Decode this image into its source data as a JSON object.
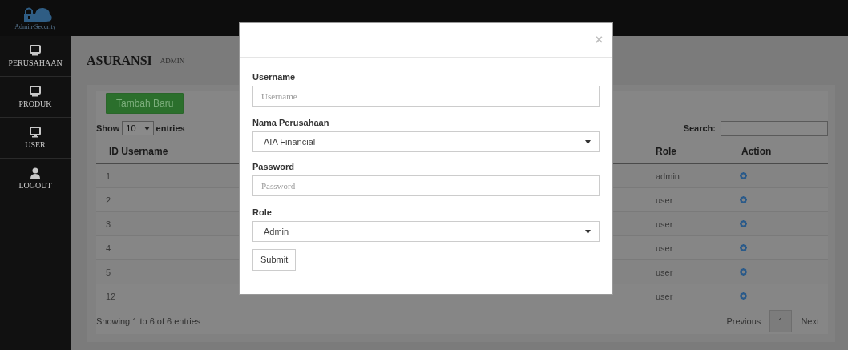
{
  "topbar": {
    "logo_text": "Admin-Security"
  },
  "sidebar": {
    "items": [
      {
        "label": "PERUSAHAAN",
        "kind": "monitor"
      },
      {
        "label": "PRODUK",
        "kind": "monitor"
      },
      {
        "label": "USER",
        "kind": "monitor"
      },
      {
        "label": "LOGOUT",
        "kind": "person"
      }
    ]
  },
  "page": {
    "title": "ASURANSI",
    "subtitle": "ADMIN"
  },
  "add_button": "Tambah Baru",
  "length_control": {
    "show": "Show",
    "value": "10",
    "entries": "entries"
  },
  "search": {
    "label": "Search:"
  },
  "table": {
    "columns": [
      "ID Username",
      "Role",
      "Action"
    ],
    "rows": [
      {
        "id": "1",
        "role": "admin"
      },
      {
        "id": "2",
        "role": "user"
      },
      {
        "id": "3",
        "role": "user"
      },
      {
        "id": "4",
        "role": "user"
      },
      {
        "id": "5",
        "role": "user"
      },
      {
        "id": "12",
        "role": "user"
      }
    ]
  },
  "footer": {
    "info": "Showing 1 to 6 of 6 entries",
    "pagination": [
      {
        "label": "Previous",
        "selected": false
      },
      {
        "label": "1",
        "selected": true
      },
      {
        "label": "Next",
        "selected": false
      }
    ]
  },
  "modal": {
    "close": "×",
    "fields": [
      {
        "label": "Username",
        "kind": "text",
        "placeholder": "Username"
      },
      {
        "label": "Nama Perusahaan",
        "kind": "select",
        "value": "AIA Financial"
      },
      {
        "label": "Password",
        "kind": "password",
        "placeholder": "Password"
      },
      {
        "label": "Role",
        "kind": "select",
        "value": "Admin"
      }
    ],
    "submit": "Submit"
  }
}
